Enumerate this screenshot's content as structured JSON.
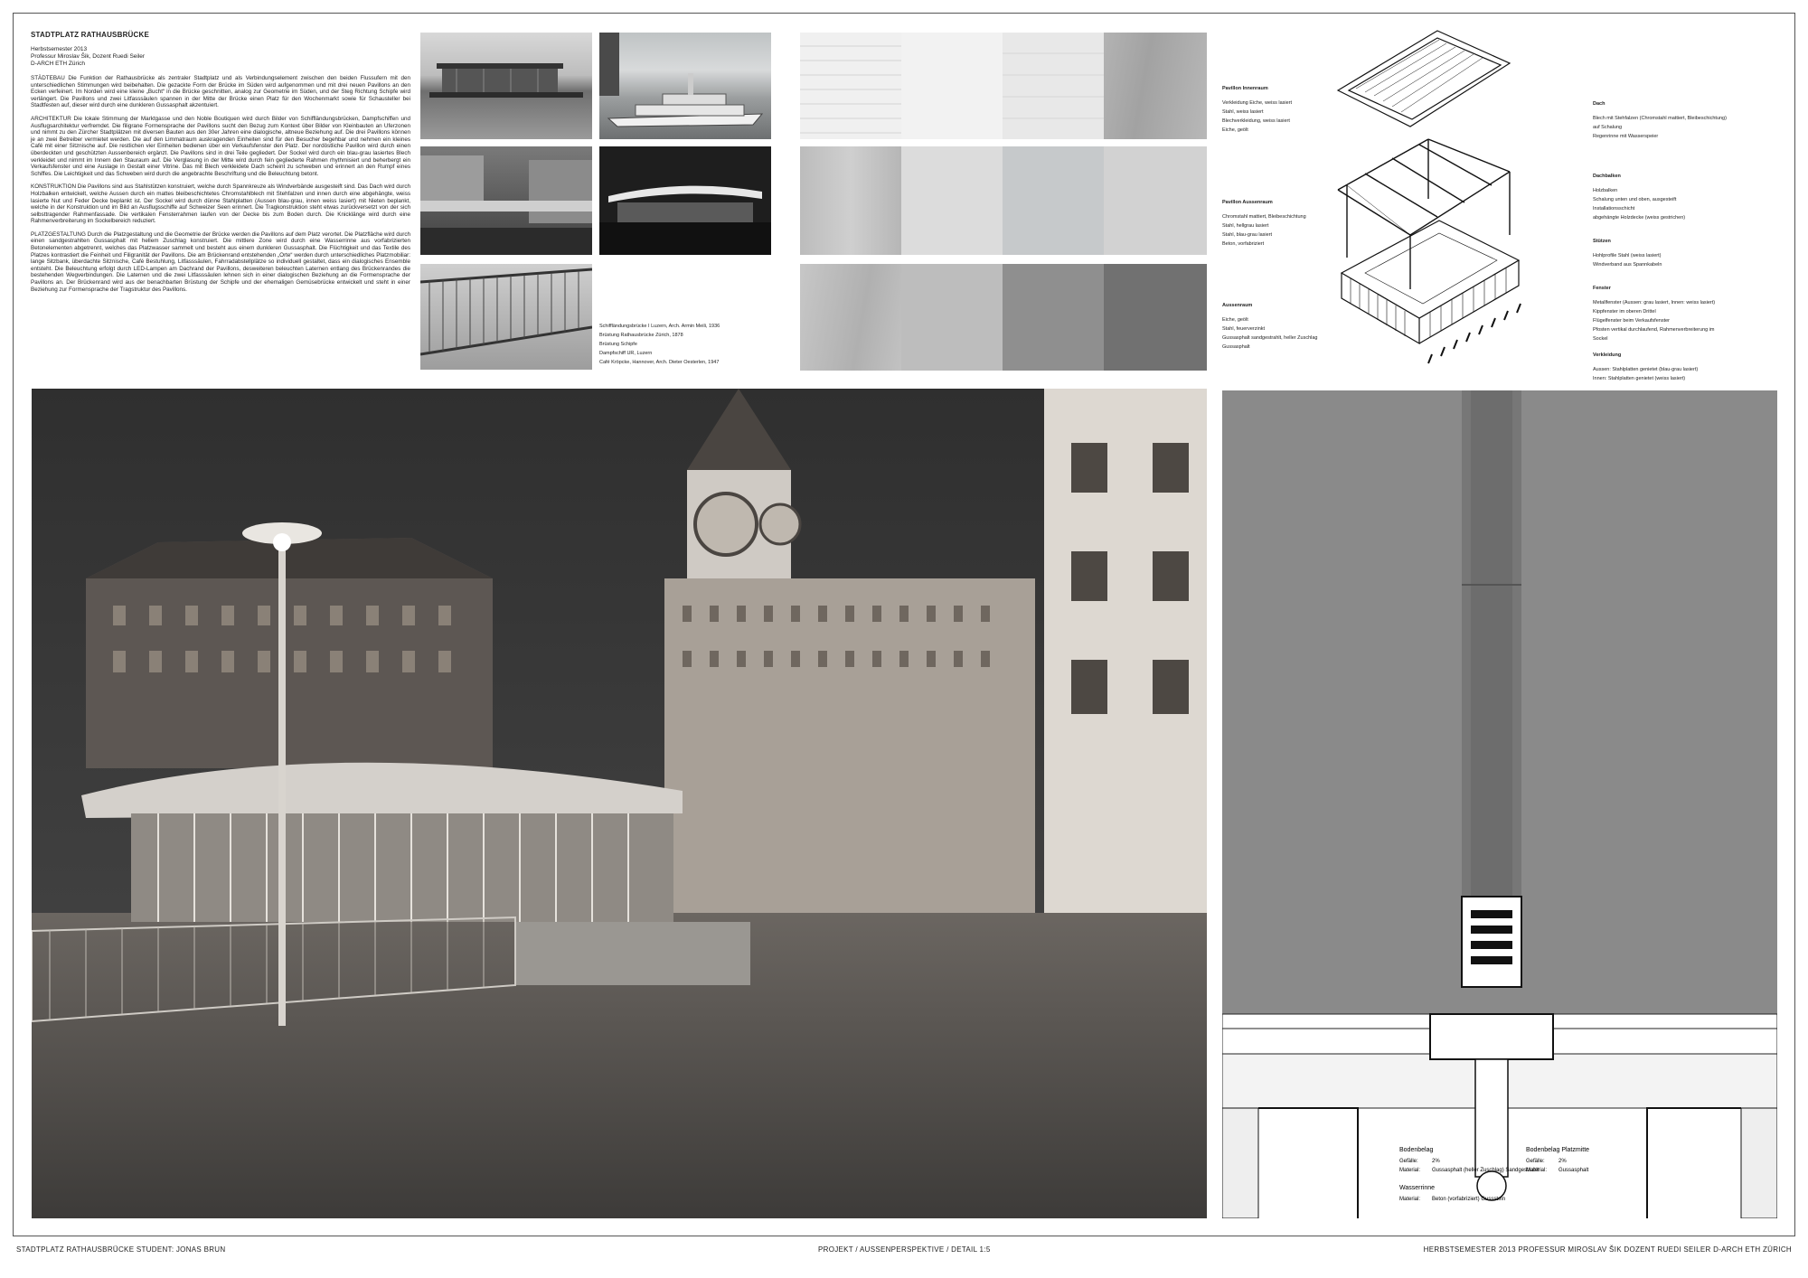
{
  "header": {
    "title": "STADTPLATZ RATHAUSBRÜCKE",
    "semester": "Herbstsemester 2013",
    "professors": "Professur Miroslav Šik, Dozent Ruedi Seiler",
    "school": "D-ARCH ETH Zürich"
  },
  "text": {
    "p1": "STÄDTEBAU Die Funktion der Rathausbrücke als zentraler Stadtplatz und als Verbindungselement zwischen den beiden Flussufern mit den unterschiedlichen Stimmungen wird beibehalten. Die gezackte Form der Brücke im Süden wird aufgenommen und mit drei neuen Pavillons an den Ecken verfeinert. Im Norden wird eine kleine „Bucht“ in die Brücke geschnitten, analog zur Geometrie im Süden, und der Steg Richtung Schipfe wird verlängert. Die Pavillons und zwei Litfasssäulen spannen in der Mitte der Brücke einen Platz für den Wochenmarkt sowie für Schausteller bei Stadtfesten auf, dieser wird durch eine dunkleren Gussasphalt akzentuiert.",
    "p2": "ARCHITEKTUR Die lokale Stimmung der Marktgasse und den Noble Boutiquen wird durch Bilder von Schiffländungsbrücken, Dampfschiffen und Ausflugsarchitektur verfremdet. Die filigrane Formensprache der Pavillons sucht den Bezug zum Kontext über Bilder von Kleinbauten an Uferzonen und nimmt zu den Zürcher Stadtplätzen mit diversen Bauten aus den 30er Jahren eine dialogische, altneue Beziehung auf. Die drei Pavillons können je an zwei Betreiber vermietet werden. Die auf den Limmatraum auskragenden Einheiten sind für den Besucher begehbar und nehmen ein kleines Café mit einer Sitznische auf. Die restlichen vier Einheiten bedienen über ein Verkaufsfenster den Platz. Der nordöstliche Pavillon wird durch einen überdeckten und geschützten Aussenbereich ergänzt. Die Pavillons sind in drei Teile gegliedert. Der Sockel wird durch ein blau-grau lasiertes Blech verkleidet und nimmt im Innern den Stauraum auf. Die Verglasung in der Mitte wird durch fein gegliederte Rahmen rhythmisiert und beherbergt ein Verkaufsfenster und eine Auslage in Gestalt einer Vitrine. Das mit Blech verkleidete Dach scheint zu schweben und erinnert an den Rumpf eines Schiffes. Die Leichtigkeit und das Schweben wird durch die angebrachte Beschriftung und die Beleuchtung betont.",
    "p3": "KONSTRUKTION Die Pavillons sind aus Stahlstützen konstruiert, welche durch Spannkreuze als Windverbände ausgesteift sind. Das Dach wird durch Holzbalken entwickelt, welche Aussen durch ein mattes bleibeschichtetes Chromstahlblech mit Stehfalzen und innen durch eine abgehängte, weiss lasierte Nut und Feder Decke beplankt ist. Der Sockel wird durch dünne Stahlplatten (Aussen blau-grau, innen weiss lasiert) mit Nieten beplankt, welche in der Konstruktion und im Bild an Ausflugsschiffe auf Schweizer Seen erinnert. Die Tragkonstruktion steht etwas zurückversetzt von der sich selbsttragender Rahmenfassade. Die vertikalen Fensterrahmen laufen von der Decke bis zum Boden durch. Die Knicklänge wird durch eine Rahmenverbreiterung im Sockelbereich reduziert.",
    "p4": "PLATZGESTALTUNG Durch die Platzgestaltung und die Geometrie der Brücke werden die Pavillons auf dem Platz verortet. Die Platzfläche wird durch einen sandgestrahlten Gussasphalt mit hellem Zuschlag konstruiert. Die mittlere Zone wird durch eine Wasserrinne aus vorfabrizierten Betonelementen abgetrennt, welches das Platzwasser sammelt und besteht aus einem dunkleren Gussasphalt. Die Flüchtigkeit und das Textile des Platzes kontrastiert die Feinheit und Filigranität der Pavillons. Die am Brückenrand entstehenden „Orte“ werden durch unterschiedliches Platzmobiliar: lange Sitzbank, überdachte Sitznische, Café Bestuhlung, Litfasssäulen, Fahrradabstellplätze so individuell gestaltet, dass ein dialogisches Ensemble entsteht. Die Beleuchtung erfolgt durch LED-Lampen am Dachrand der Pavillons, desweiteren beleuchten Laternen entlang des Brückenrandes die bestehenden Wegverbindungen. Die Laternen und die zwei Litfasssäulen lehnen sich in einer dialogischen Beziehung an die Formensprache der Pavillons an. Der Brückenrand wird aus der benachbarten Brüstung der Schipfe und der ehemaligen Gemüsebrücke entwickelt und steht in einer Beziehung zur Formensprache der Tragstruktur des Pavillons."
  },
  "references": [
    "Schiffländungsbrücke I Luzern, Arch. Armin Meili, 1936",
    "Brüstung Rathausbrücke Zürich, 1878",
    "Brüstung Schipfe",
    "Dampfschiff UR, Luzern",
    "Café Kröpcke, Hannover, Arch. Dieter Oesterlen, 1947"
  ],
  "legend_left": [
    {
      "heading": "Pavillon Innenraum",
      "items": [
        "Verkleidung Eiche, weiss lasiert",
        "Stahl, weiss lasiert",
        "Blechverkleidung, weiss lasiert",
        "Eiche, geölt"
      ]
    },
    {
      "heading": "Pavillon Aussenraum",
      "items": [
        "Chromstahl mattiert, Bleibeschichtung",
        "Stahl, hellgrau lasiert",
        "Stahl, blau-grau lasiert",
        "Beton, vorfabriziert"
      ]
    },
    {
      "heading": "Aussenraum",
      "items": [
        "Eiche, geölt",
        "Stahl, feuerverzinkt",
        "Gussasphalt sandgestrahlt, heller Zuschlag",
        "Gussasphalt"
      ]
    }
  ],
  "legend_right": [
    {
      "heading": "Dach",
      "items": [
        "Blech mit Stehfalzen (Chromstahl mattiert, Bleibeschichtung) auf Schalung",
        "Regenrinne mit Wasserspeier"
      ]
    },
    {
      "heading": "Dachbalken",
      "items": [
        "Holzbalken",
        "Schalung unten und oben, ausgesteift",
        "Installationsschicht",
        "abgehängte Holzdecke (weiss gestrichen)"
      ]
    },
    {
      "heading": "Stützen",
      "items": [
        "Hohlprofile Stahl (weiss lasiert)",
        "Windverband aus Spannkabeln"
      ]
    },
    {
      "heading": "Fenster",
      "items": [
        "Metallfenster (Aussen: grau lasiert, Innen: weiss lasiert)",
        "Kippfenster im oberen Drittel",
        "Flügelfenster beim Verkaufsfenster",
        "Pfosten vertikal durchlaufend, Rahmenverbreiterung im Sockel"
      ]
    },
    {
      "heading": "Verkleidung",
      "items": [
        "Aussen: Stahlplatten genietet (blau-grau lasiert)",
        "Innen: Stahlplatten genietet (weiss lasiert)"
      ]
    }
  ],
  "detail": {
    "label_a": "Bodenbelag",
    "a_slope_k": "Gefälle:",
    "a_slope_v": "2%",
    "a_mat_k": "Material:",
    "a_mat_v": "Gussasphalt (heller Zuschlag) Sandgestrahlt",
    "label_b": "Bodenbelag Platzmitte",
    "b_slope_k": "Gefälle:",
    "b_slope_v": "2%",
    "b_mat_k": "Material:",
    "b_mat_v": "Gussasphalt",
    "label_c": "Wasserrinne",
    "c_mat_k": "Material:",
    "c_mat_v": "Beton (vorfabriziert) Gussstein"
  },
  "footer": {
    "left": "STADTPLATZ RATHAUSBRÜCKE    STUDENT: JONAS BRUN",
    "center": "PROJEKT / AUSSENPERSPEKTIVE / DETAIL 1:5",
    "right": "HERBSTSEMESTER 2013   PROFESSUR MIROSLAV ŠIK   DOZENT RUEDI SEILER   D-ARCH   ETH ZÜRICH"
  },
  "colors": {
    "sky": "#3a3a3a",
    "stone": "#8a8a8a",
    "paper": "#ffffff"
  }
}
